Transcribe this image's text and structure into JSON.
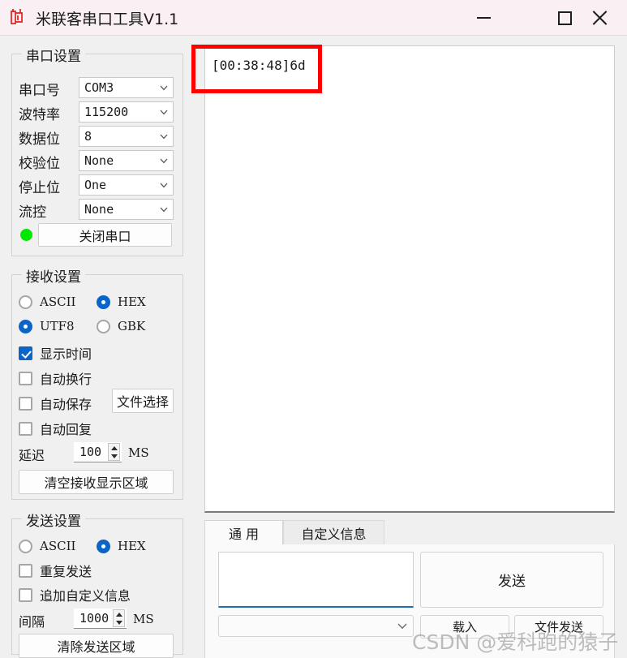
{
  "window": {
    "title": "米联客串口工具V1.1",
    "logo_icon": "mlk-logo-icon",
    "minimize_label": "—",
    "maximize_label": "□",
    "close_label": "✕",
    "titlebar_color": "#faeff2"
  },
  "serial_settings": {
    "title": "串口设置",
    "fields": [
      {
        "label": "串口号",
        "value": "COM3"
      },
      {
        "label": "波特率",
        "value": "115200"
      },
      {
        "label": "数据位",
        "value": "8"
      },
      {
        "label": "校验位",
        "value": "None"
      },
      {
        "label": "停止位",
        "value": "One"
      },
      {
        "label": "流控",
        "value": "None"
      }
    ],
    "status_led_color": "#00e800",
    "toggle_button": "关闭串口"
  },
  "receive_settings": {
    "title": "接收设置",
    "format_options": [
      {
        "label": "ASCII",
        "selected": false
      },
      {
        "label": "HEX",
        "selected": true
      }
    ],
    "encoding_options": [
      {
        "label": "UTF8",
        "selected": true
      },
      {
        "label": "GBK",
        "selected": false
      }
    ],
    "checkboxes": [
      {
        "label": "显示时间",
        "checked": true
      },
      {
        "label": "自动换行",
        "checked": false
      },
      {
        "label": "自动保存",
        "checked": false
      },
      {
        "label": "自动回复",
        "checked": false
      }
    ],
    "file_select_button": "文件选择",
    "delay_label": "延迟",
    "delay_value": "100",
    "delay_unit": "MS",
    "clear_button": "清空接收显示区域"
  },
  "send_settings": {
    "title": "发送设置",
    "format_options": [
      {
        "label": "ASCII",
        "selected": false
      },
      {
        "label": "HEX",
        "selected": true
      }
    ],
    "checkboxes": [
      {
        "label": "重复发送",
        "checked": false
      },
      {
        "label": "追加自定义信息",
        "checked": false
      }
    ],
    "interval_label": "间隔",
    "interval_value": "1000",
    "interval_unit": "MS",
    "clear_button": "清除发送区域"
  },
  "receive_area": {
    "content": "[00:38:48]6d",
    "annotation_color": "#fe0000"
  },
  "tabs": [
    {
      "label": "通  用",
      "active": true
    },
    {
      "label": "自定义信息",
      "active": false
    }
  ],
  "send_panel": {
    "input_value": "",
    "send_button": "发送",
    "history_value": "",
    "load_button": "载入",
    "file_send_button": "文件发送"
  },
  "watermark": {
    "text": "CSDN @爱科跑的猿子"
  }
}
